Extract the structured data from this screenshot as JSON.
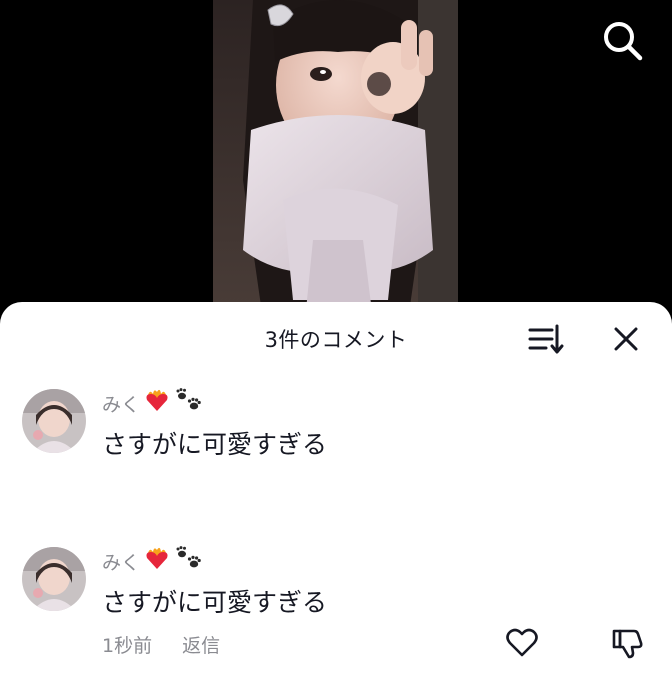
{
  "header": {
    "search_icon": "search-icon"
  },
  "comments_sheet": {
    "title": "3件のコメント",
    "sort_icon": "sort-icon",
    "close_icon": "close-icon"
  },
  "comments": [
    {
      "username": "みく",
      "username_emojis": [
        "heart-on-fire-icon",
        "paw-prints-icon"
      ],
      "text": "さすがに可愛すぎる"
    },
    {
      "username": "みく",
      "username_emojis": [
        "heart-on-fire-icon",
        "paw-prints-icon"
      ],
      "text": "さすがに可愛すぎる",
      "time": "1秒前",
      "reply_label": "返信",
      "like_icon": "heart-outline-icon",
      "dislike_icon": "thumbs-down-icon"
    }
  ],
  "colors": {
    "sheet_bg": "#ffffff",
    "primary_text": "#161823",
    "secondary_text": "#8a8b91",
    "video_bg": "#000000"
  }
}
